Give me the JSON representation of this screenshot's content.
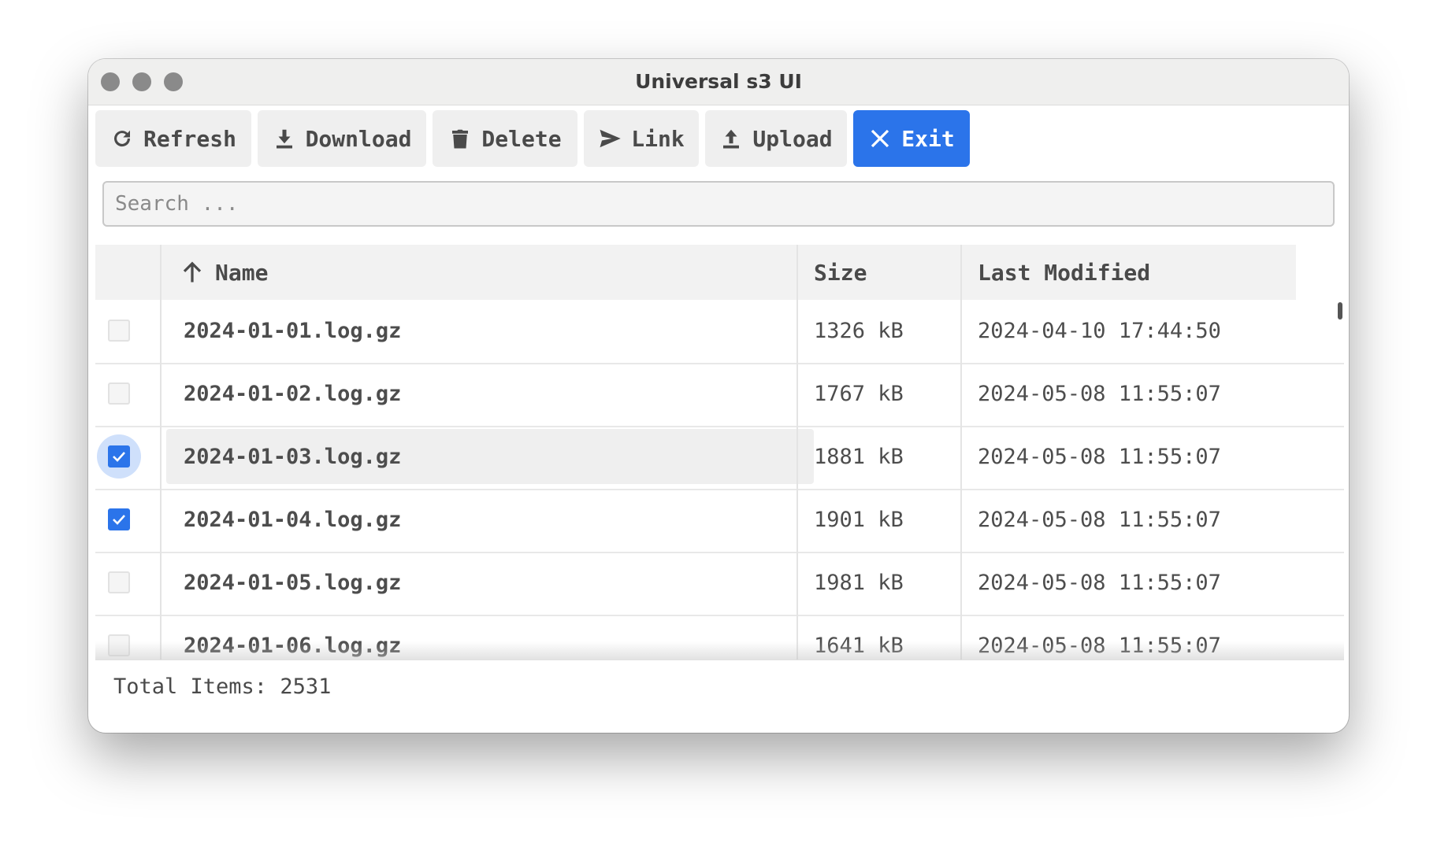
{
  "window": {
    "title": "Universal s3 UI"
  },
  "toolbar": {
    "refresh": {
      "label": "Refresh",
      "icon": "refresh-icon"
    },
    "download": {
      "label": "Download",
      "icon": "download-icon"
    },
    "delete": {
      "label": "Delete",
      "icon": "trash-icon"
    },
    "link": {
      "label": "Link",
      "icon": "send-icon"
    },
    "upload": {
      "label": "Upload",
      "icon": "upload-icon"
    },
    "exit": {
      "label": "Exit",
      "icon": "close-icon"
    }
  },
  "search": {
    "placeholder": "Search ...",
    "value": ""
  },
  "table": {
    "sort": {
      "column": "Name",
      "direction": "ascending"
    },
    "columns": [
      "Name",
      "Size",
      "Last Modified"
    ],
    "rows": [
      {
        "checked": false,
        "name": "2024-01-01.log.gz",
        "size": "1326 kB",
        "modified": "2024-04-10 17:44:50"
      },
      {
        "checked": false,
        "name": "2024-01-02.log.gz",
        "size": "1767 kB",
        "modified": "2024-05-08 11:55:07"
      },
      {
        "checked": true,
        "name": "2024-01-03.log.gz",
        "size": "1881 kB",
        "modified": "2024-05-08 11:55:07"
      },
      {
        "checked": true,
        "name": "2024-01-04.log.gz",
        "size": "1901 kB",
        "modified": "2024-05-08 11:55:07"
      },
      {
        "checked": false,
        "name": "2024-01-05.log.gz",
        "size": "1981 kB",
        "modified": "2024-05-08 11:55:07"
      },
      {
        "checked": false,
        "name": "2024-01-06.log.gz",
        "size": "1641 kB",
        "modified": "2024-05-08 11:55:07"
      }
    ]
  },
  "footer": {
    "total": "Total Items: 2531"
  },
  "colors": {
    "accent": "#2b74ea",
    "button_bg": "#efefef",
    "titlebar": "#efefee"
  }
}
